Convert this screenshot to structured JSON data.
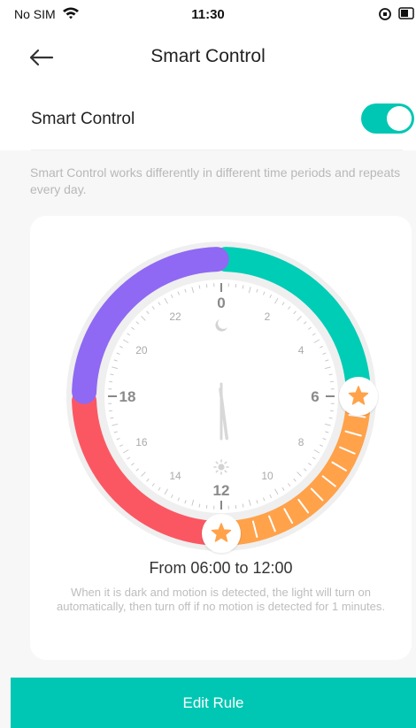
{
  "status_bar": {
    "carrier": "No SIM",
    "time": "11:30",
    "wifi_icon": "wifi-icon",
    "battery_icon": "battery-icon"
  },
  "header": {
    "back_icon": "arrow-left-icon",
    "title": "Smart Control"
  },
  "smart_control": {
    "label": "Smart Control",
    "enabled": true,
    "description": "Smart Control works differently in different time periods and repeats every day."
  },
  "dial": {
    "hour_labels": [
      "0",
      "2",
      "4",
      "6",
      "8",
      "10",
      "12",
      "14",
      "16",
      "18",
      "20",
      "22"
    ],
    "segments": [
      {
        "from": 0,
        "to": 6,
        "color": "#00cdb5"
      },
      {
        "from": 6,
        "to": 12,
        "color": "#ffa24a",
        "selected": true
      },
      {
        "from": 12,
        "to": 18,
        "color": "#fb5763"
      },
      {
        "from": 18,
        "to": 24,
        "color": "#8f69f3"
      }
    ],
    "current_time": "11:30",
    "night_icon": "moon-icon",
    "day_icon": "sun-icon",
    "handle_icon": "star-icon"
  },
  "selection": {
    "range_text": "From 06:00 to 12:00",
    "rule_description": "When it is dark and motion is detected, the light will turn on automatically, then turn off if no motion is detected for 1 minutes."
  },
  "footer": {
    "edit_label": "Edit Rule"
  },
  "colors": {
    "accent": "#00c7b3",
    "card_bg": "#ffffff",
    "page_bg": "#f7f7f7"
  }
}
